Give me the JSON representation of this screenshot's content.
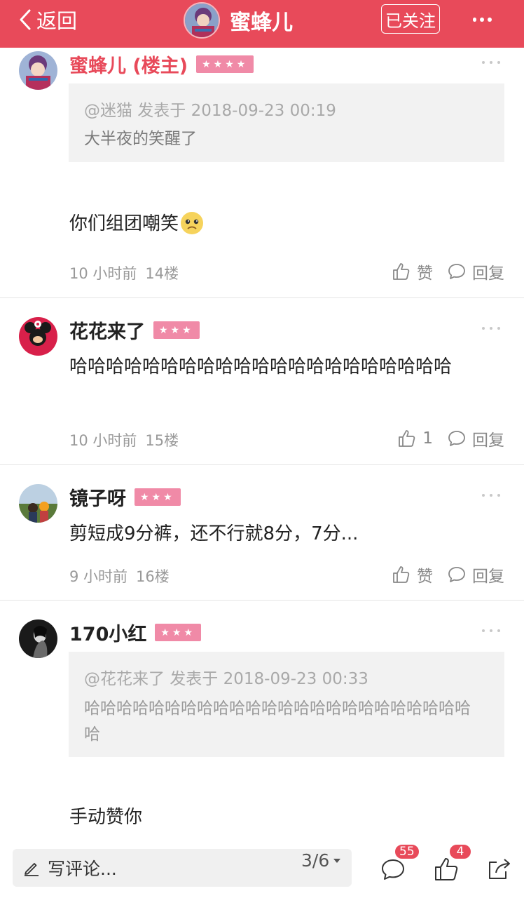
{
  "header": {
    "back_label": "返回",
    "title": "蜜蜂儿",
    "follow_label": "已关注",
    "accent": "#e84a5a"
  },
  "comments": [
    {
      "username": "蜜蜂儿 (楼主)",
      "badge": "★★★★",
      "quote": {
        "meta": "@迷猫 发表于 2018-09-23 00:19",
        "text": "大半夜的笑醒了"
      },
      "text": "你们组团嘲笑",
      "emoji": "upset-face-emoji",
      "time": "10 小时前",
      "floor": "14楼",
      "like_label": "赞",
      "reply_label": "回复"
    },
    {
      "username": "花花来了",
      "badge": "★★★",
      "text": "哈哈哈哈哈哈哈哈哈哈哈哈哈哈哈哈哈哈哈哈哈",
      "time": "10 小时前",
      "floor": "15楼",
      "like_label": "1",
      "reply_label": "回复"
    },
    {
      "username": "镜子呀",
      "badge": "★★★",
      "text": "剪短成9分裤，还不行就8分，7分...",
      "time": "9 小时前",
      "floor": "16楼",
      "like_label": "赞",
      "reply_label": "回复"
    },
    {
      "username": "170小红",
      "badge": "★★★",
      "quote": {
        "meta": "@花花来了 发表于 2018-09-23 00:33",
        "text": "哈哈哈哈哈哈哈哈哈哈哈哈哈哈哈哈哈哈哈哈哈哈哈哈哈"
      },
      "text": "手动赞你"
    }
  ],
  "bottombar": {
    "write_label": "写评论...",
    "page_indicator": "3/6",
    "comment_count": "55",
    "like_count": "4"
  }
}
